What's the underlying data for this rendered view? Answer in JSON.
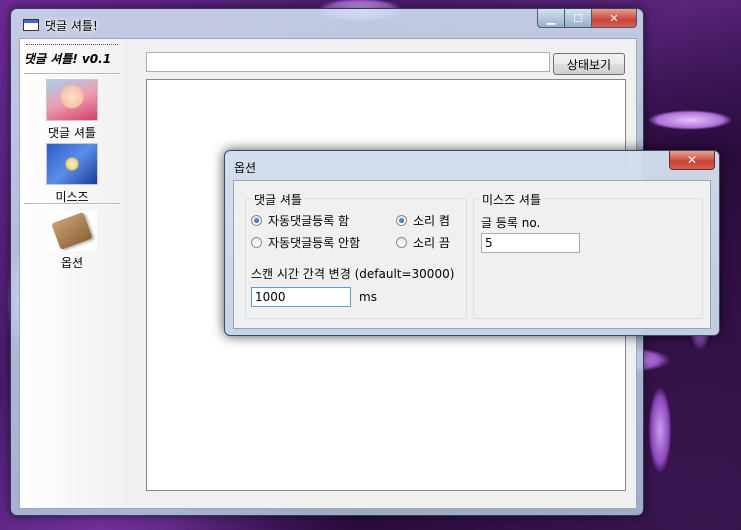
{
  "window": {
    "title": "댓글 셔틀!",
    "controls": {
      "minimize": "▁",
      "maximize": "☐",
      "close": "✕"
    }
  },
  "sidebar": {
    "app_title": "댓글 셔틀! v0.1",
    "items": [
      {
        "label": "댓글 셔틀",
        "icon": "anime-girl-icon"
      },
      {
        "label": "미스즈",
        "icon": "star-icon"
      },
      {
        "label": "옵션",
        "icon": "scroll-icon"
      }
    ]
  },
  "toolbar": {
    "url_value": "",
    "status_button": "상태보기"
  },
  "dialog": {
    "title": "옵션",
    "close": "✕",
    "comment_group": {
      "title": "댓글 셔틀",
      "auto_on": "자동댓글등록 함",
      "auto_off": "자동댓글등록 안함",
      "sound_on": "소리 켬",
      "sound_off": "소리 끔",
      "auto_selected": "자동댓글등록 함",
      "sound_selected": "소리 켬",
      "scan_label": "스캔 시간 간격 변경 (default=30000)",
      "scan_value": "1000",
      "scan_unit": "ms"
    },
    "misuzu_group": {
      "title": "미스즈 셔틀",
      "post_label": "글 등록 no.",
      "post_value": "5"
    }
  },
  "colors": {
    "accent": "#569de5",
    "close_red": "#c8453a",
    "radio_fill": "#1a4a8a"
  }
}
